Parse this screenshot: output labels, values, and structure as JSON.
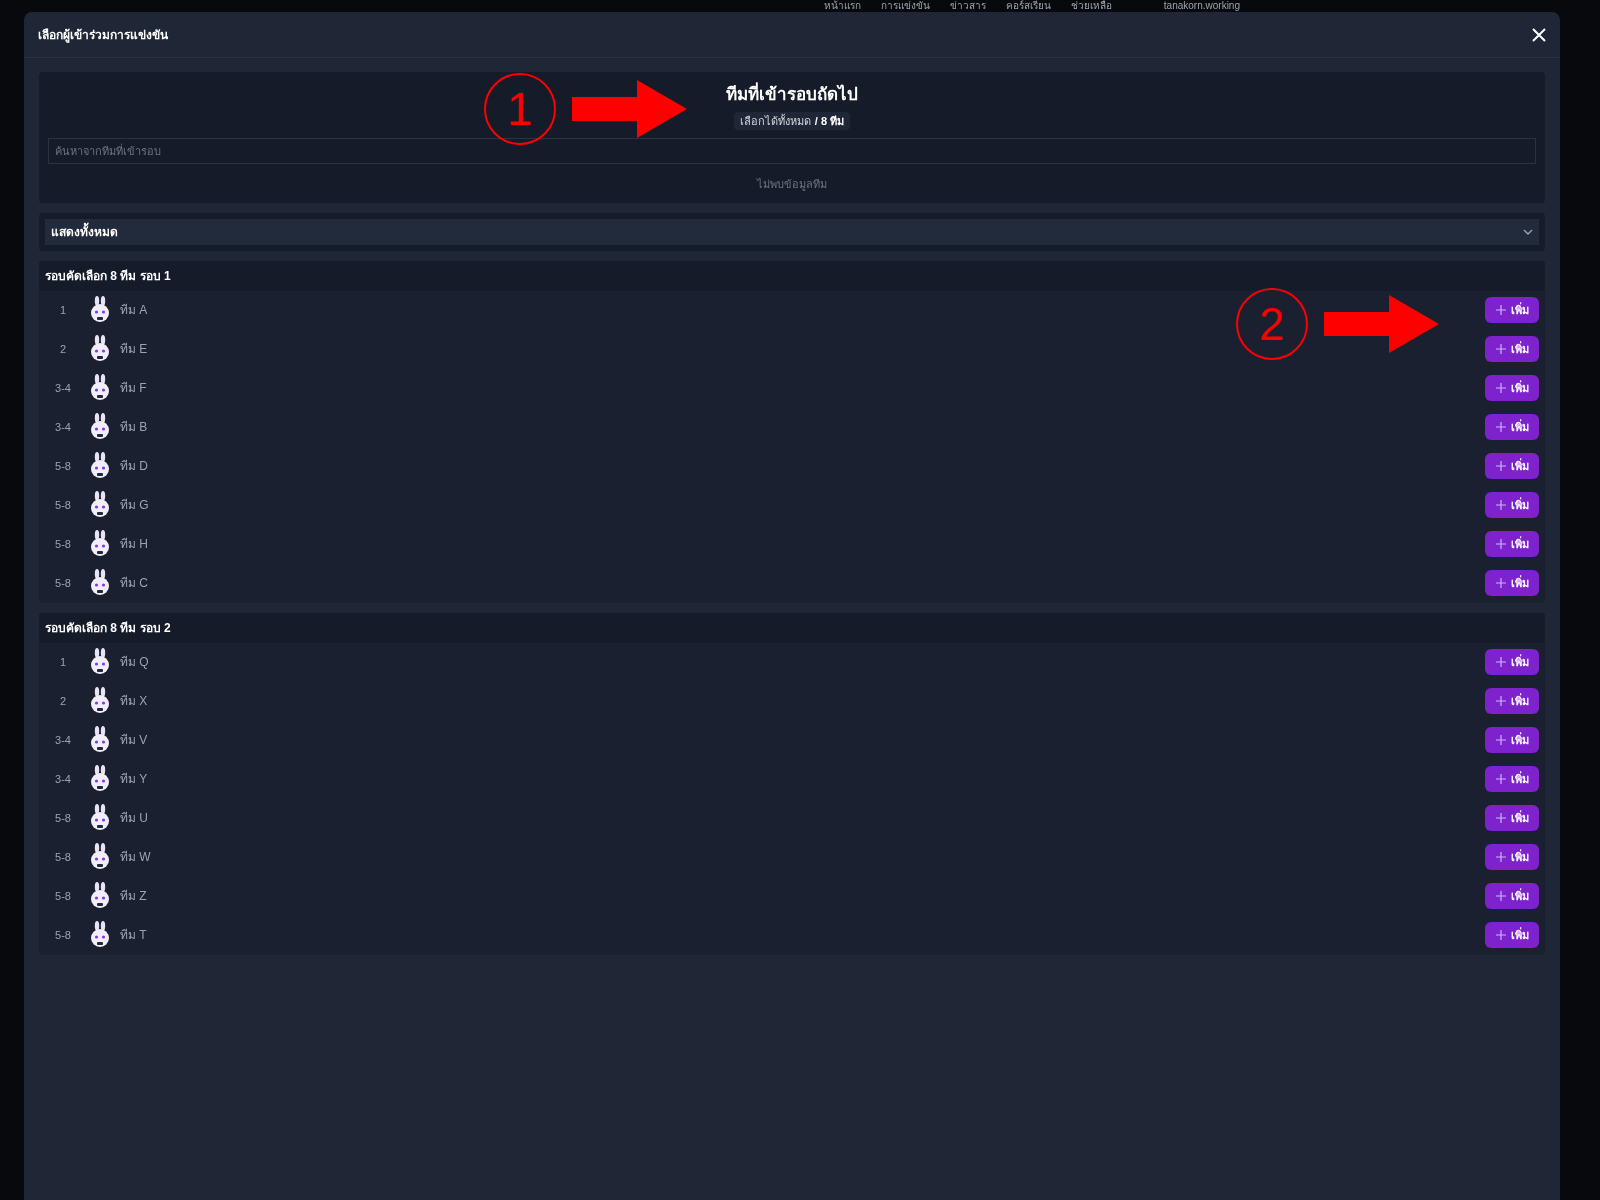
{
  "background_nav": {
    "items": [
      "หน้าแรก",
      "การแข่งขัน",
      "ข่าวสาร",
      "คอร์สเรียน",
      "ช่วยเหลือ"
    ],
    "username": "tanakorn.working"
  },
  "dialog": {
    "title": "เลือกผู้เข้าร่วมการแข่งขัน"
  },
  "next_round": {
    "title": "ทีมที่เข้ารอบถัดไป",
    "quota_label": "เลือกได้ทั้งหมด",
    "quota_value": "/ 8 ทีม",
    "search": {
      "placeholder": "ค้นหาจากทีมที่เข้ารอบ"
    },
    "empty_text": "ไม่พบข้อมูลทีม"
  },
  "filter": {
    "value": "แสดงทั้งหมด"
  },
  "groups": [
    {
      "title": "รอบคัดเลือก 8 ทีม รอบ 1",
      "rows": [
        {
          "rank": "1",
          "team": "ทีม A",
          "button": "เพิ่ม"
        },
        {
          "rank": "2",
          "team": "ทีม E",
          "button": "เพิ่ม"
        },
        {
          "rank": "3-4",
          "team": "ทีม F",
          "button": "เพิ่ม"
        },
        {
          "rank": "3-4",
          "team": "ทีม B",
          "button": "เพิ่ม"
        },
        {
          "rank": "5-8",
          "team": "ทีม D",
          "button": "เพิ่ม"
        },
        {
          "rank": "5-8",
          "team": "ทีม G",
          "button": "เพิ่ม"
        },
        {
          "rank": "5-8",
          "team": "ทีม H",
          "button": "เพิ่ม"
        },
        {
          "rank": "5-8",
          "team": "ทีม C",
          "button": "เพิ่ม"
        }
      ]
    },
    {
      "title": "รอบคัดเลือก 8 ทีม รอบ 2",
      "rows": [
        {
          "rank": "1",
          "team": "ทีม Q",
          "button": "เพิ่ม"
        },
        {
          "rank": "2",
          "team": "ทีม X",
          "button": "เพิ่ม"
        },
        {
          "rank": "3-4",
          "team": "ทีม V",
          "button": "เพิ่ม"
        },
        {
          "rank": "3-4",
          "team": "ทีม Y",
          "button": "เพิ่ม"
        },
        {
          "rank": "5-8",
          "team": "ทีม U",
          "button": "เพิ่ม"
        },
        {
          "rank": "5-8",
          "team": "ทีม W",
          "button": "เพิ่ม"
        },
        {
          "rank": "5-8",
          "team": "ทีม Z",
          "button": "เพิ่ม"
        },
        {
          "rank": "5-8",
          "team": "ทีม T",
          "button": "เพิ่ม"
        }
      ]
    }
  ],
  "annotations": [
    {
      "number": "1"
    },
    {
      "number": "2"
    }
  ]
}
